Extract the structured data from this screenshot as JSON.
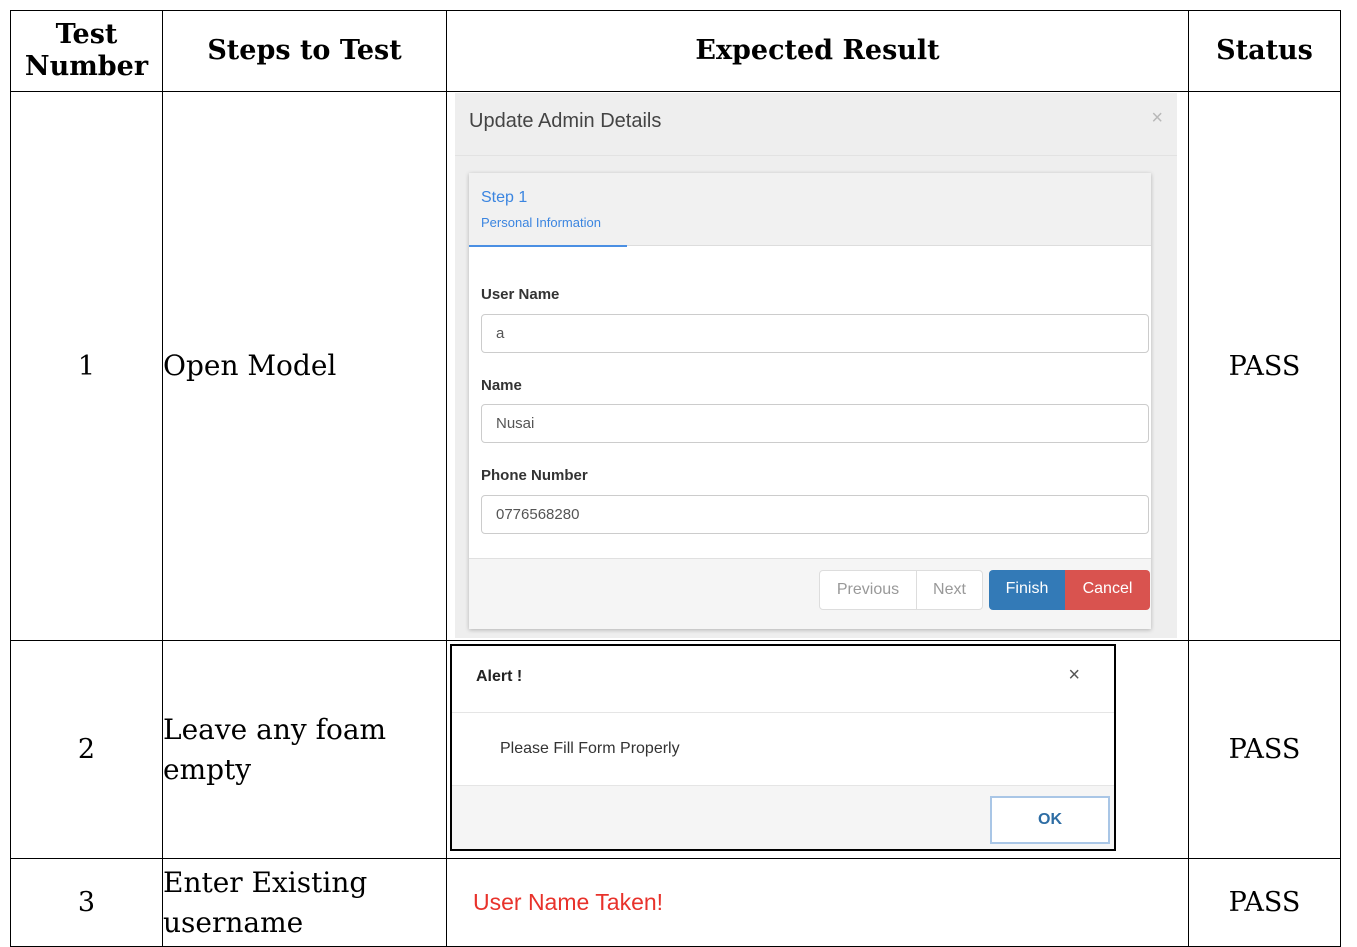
{
  "headers": {
    "test_number": "Test Number",
    "steps": "Steps to Test",
    "expected": "Expected Result",
    "status": "Status"
  },
  "rows": [
    {
      "number": "1",
      "steps": "Open Model",
      "status": "PASS"
    },
    {
      "number": "2",
      "steps": "Leave any foam empty",
      "status": "PASS"
    },
    {
      "number": "3",
      "steps": "Enter Existing username",
      "status": "PASS"
    }
  ],
  "update_modal": {
    "title": "Update Admin Details",
    "close": "×",
    "step_title": "Step 1",
    "step_subtitle": "Personal Information",
    "fields": [
      {
        "label": "User Name",
        "value": "a"
      },
      {
        "label": "Name",
        "value": "Nusai"
      },
      {
        "label": "Phone Number",
        "value": "0776568280"
      }
    ],
    "buttons": {
      "previous": "Previous",
      "next": "Next",
      "finish": "Finish",
      "cancel": "Cancel"
    },
    "colors": {
      "step_accent": "#3b85e0",
      "finish": "#337ab7",
      "cancel": "#d9534f"
    }
  },
  "alert_modal": {
    "title": "Alert !",
    "close": "×",
    "message": "Please Fill Form Properly",
    "ok": "OK"
  },
  "taken_message": "User Name Taken!",
  "taken_color": "#e8322b"
}
